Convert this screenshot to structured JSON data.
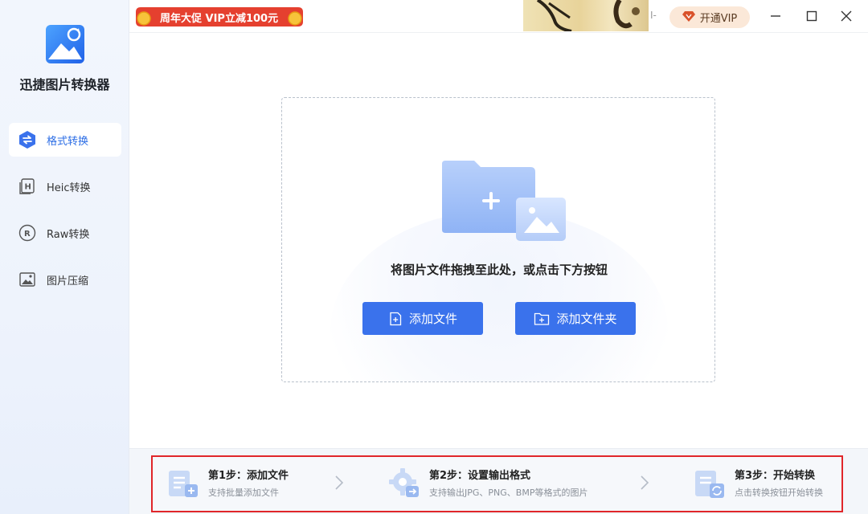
{
  "sidebar": {
    "app_name": "迅捷图片转换器",
    "items": [
      {
        "label": "格式转换",
        "icon": "swap-icon",
        "active": true
      },
      {
        "label": "Heic转换",
        "icon": "heic-icon",
        "active": false
      },
      {
        "label": "Raw转换",
        "icon": "raw-icon",
        "active": false
      },
      {
        "label": "图片压缩",
        "icon": "image-compress-icon",
        "active": false
      }
    ]
  },
  "topbar": {
    "promo": "周年大促 VIP立减100元",
    "ad_extra": "I-",
    "vip_label": "开通VIP"
  },
  "dropzone": {
    "hint": "将图片文件拖拽至此处，或点击下方按钮",
    "add_file": "添加文件",
    "add_folder": "添加文件夹"
  },
  "steps": [
    {
      "title": "第1步：添加文件",
      "desc": "支持批量添加文件"
    },
    {
      "title": "第2步：设置输出格式",
      "desc": "支持输出JPG、PNG、BMP等格式的图片"
    },
    {
      "title": "第3步：开始转换",
      "desc": "点击转换按钮开始转换"
    }
  ],
  "colors": {
    "accent": "#3a72ec",
    "promo": "#e5402f",
    "highlight_border": "#e0262a"
  }
}
